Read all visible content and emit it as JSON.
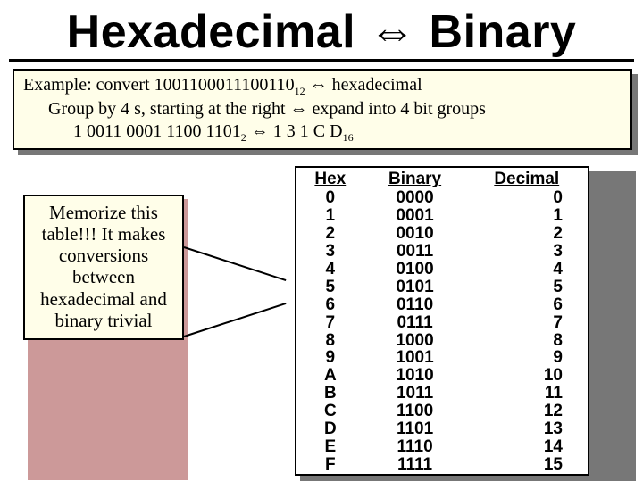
{
  "title_left": "Hexadecimal",
  "title_right": "Binary",
  "arrow_double": "⇔",
  "example": {
    "l1_a": "Example: convert 1001100011100110",
    "l1_sub": "12",
    "l1_b": " ⇔  hexadecimal",
    "l2": "Group by 4 s, starting at the right ⇔ expand into 4 bit groups",
    "l3_a": "1 0011 0001 1100 1101",
    "l3_sub": "2",
    "l3_b": " ⇔ 1 3 1 C D",
    "l3_sub2": "16"
  },
  "memo": "Memorize this table!!! It makes conversions between hexadecimal and binary trivial",
  "table": {
    "headers": {
      "hex": "Hex",
      "bin": "Binary",
      "dec": "Decimal"
    },
    "rows": [
      {
        "hex": "0",
        "bin": "0000",
        "dec": "0"
      },
      {
        "hex": "1",
        "bin": "0001",
        "dec": "1"
      },
      {
        "hex": "2",
        "bin": "0010",
        "dec": "2"
      },
      {
        "hex": "3",
        "bin": "0011",
        "dec": "3"
      },
      {
        "hex": "4",
        "bin": "0100",
        "dec": "4"
      },
      {
        "hex": "5",
        "bin": "0101",
        "dec": "5"
      },
      {
        "hex": "6",
        "bin": "0110",
        "dec": "6"
      },
      {
        "hex": "7",
        "bin": "0111",
        "dec": "7"
      },
      {
        "hex": "8",
        "bin": "1000",
        "dec": "8"
      },
      {
        "hex": "9",
        "bin": "1001",
        "dec": "9"
      },
      {
        "hex": "A",
        "bin": "1010",
        "dec": "10"
      },
      {
        "hex": "B",
        "bin": "1011",
        "dec": "11"
      },
      {
        "hex": "C",
        "bin": "1100",
        "dec": "12"
      },
      {
        "hex": "D",
        "bin": "1101",
        "dec": "13"
      },
      {
        "hex": "E",
        "bin": "1110",
        "dec": "14"
      },
      {
        "hex": "F",
        "bin": "1111",
        "dec": "15"
      }
    ]
  }
}
